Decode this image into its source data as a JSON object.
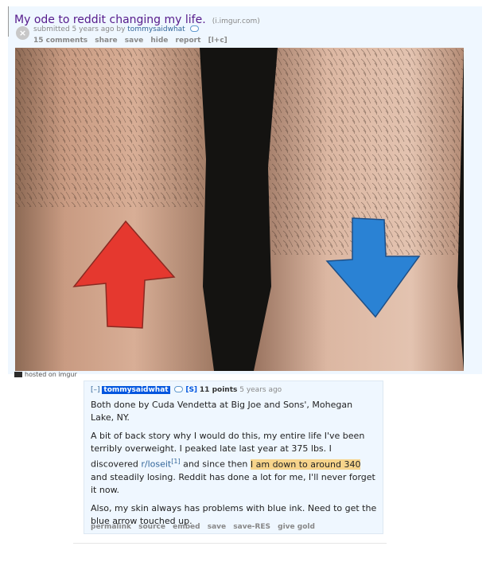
{
  "post": {
    "title": "My ode to reddit changing my life.",
    "domain": "(i.imgur.com)",
    "tagline_prefix": "submitted 5 years ago by",
    "author": "tommysaidwhat",
    "buttons": {
      "comments": "15 comments",
      "share": "share",
      "save": "save",
      "hide": "hide",
      "report": "report",
      "expand": "[l+c]"
    },
    "image": {
      "subject": "two ankle tattoos: red up arrow on left leg, blue down arrow on right leg",
      "colors": {
        "up_arrow": "#e83b34",
        "down_arrow": "#2a7fd0",
        "skin": "#d8ad93"
      }
    },
    "hosted_on": "hosted on imgur"
  },
  "comment": {
    "expand": "[–]",
    "user": "tommysaidwhat",
    "submitter_flag": "[S]",
    "points": "11 points",
    "age": "5 years ago",
    "p1": "Both done by Cuda Vendetta at Big Joe and Sons', Mohegan Lake, NY.",
    "p2_a": "A bit of back story why I would do this, my entire life I've been terribly overweight. I peaked late last year at 375 lbs. I discovered ",
    "p2_link": "r/loseit",
    "p2_sup": "[1]",
    "p2_b": " and since then ",
    "p2_highlight": "I am down to around 340",
    "p2_c": " and steadily losing. Reddit has done a lot for me, I'll never forget it now.",
    "p3": "Also, my skin always has problems with blue ink. Need to get the blue arrow touched up.",
    "buttons": {
      "permalink": "permalink",
      "source": "source",
      "embed": "embed",
      "save": "save",
      "save_res": "save-RES",
      "give_gold": "give gold"
    }
  }
}
